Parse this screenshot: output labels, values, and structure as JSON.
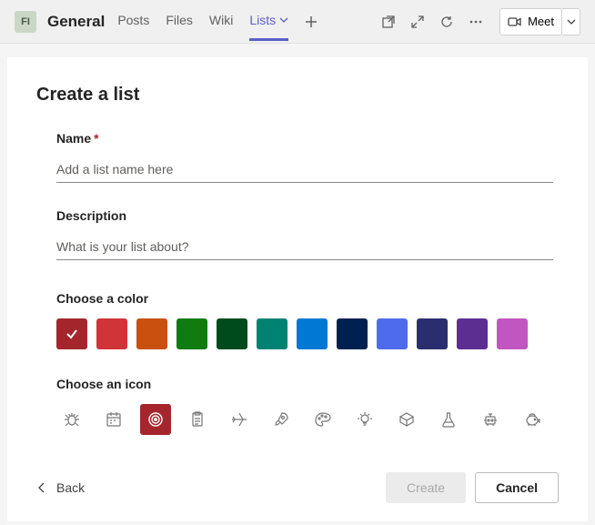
{
  "topbar": {
    "team_initials": "FI",
    "channel_name": "General",
    "tabs": [
      "Posts",
      "Files",
      "Wiki",
      "Lists"
    ],
    "active_tab_index": 3,
    "meet_label": "Meet"
  },
  "dialog": {
    "title": "Create a list",
    "name_label": "Name",
    "name_placeholder": "Add a list name here",
    "name_value": "",
    "description_label": "Description",
    "description_placeholder": "What is your list about?",
    "description_value": "",
    "color_label": "Choose a color",
    "colors": [
      {
        "name": "dark-red",
        "hex": "#a4262c",
        "selected": true
      },
      {
        "name": "red",
        "hex": "#d13438",
        "selected": false
      },
      {
        "name": "orange",
        "hex": "#ca5010",
        "selected": false
      },
      {
        "name": "green",
        "hex": "#107c10",
        "selected": false
      },
      {
        "name": "dark-green",
        "hex": "#004b1c",
        "selected": false
      },
      {
        "name": "teal",
        "hex": "#008272",
        "selected": false
      },
      {
        "name": "blue",
        "hex": "#0078d4",
        "selected": false
      },
      {
        "name": "dark-blue",
        "hex": "#002050",
        "selected": false
      },
      {
        "name": "indigo",
        "hex": "#4f6bed",
        "selected": false
      },
      {
        "name": "navy",
        "hex": "#2a2e6e",
        "selected": false
      },
      {
        "name": "purple",
        "hex": "#5c2e91",
        "selected": false
      },
      {
        "name": "pink",
        "hex": "#c156c1",
        "selected": false
      }
    ],
    "icon_label": "Choose an icon",
    "icons": [
      {
        "name": "bug",
        "selected": false
      },
      {
        "name": "calendar",
        "selected": false
      },
      {
        "name": "target",
        "selected": true
      },
      {
        "name": "clipboard",
        "selected": false
      },
      {
        "name": "airplane",
        "selected": false
      },
      {
        "name": "rocket",
        "selected": false
      },
      {
        "name": "palette",
        "selected": false
      },
      {
        "name": "lightbulb",
        "selected": false
      },
      {
        "name": "cube",
        "selected": false
      },
      {
        "name": "flask",
        "selected": false
      },
      {
        "name": "robot",
        "selected": false
      },
      {
        "name": "piggy-bank",
        "selected": false
      }
    ],
    "back_label": "Back",
    "create_label": "Create",
    "cancel_label": "Cancel"
  }
}
